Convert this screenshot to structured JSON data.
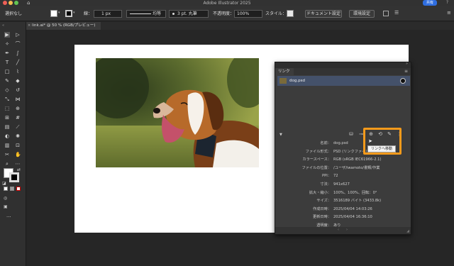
{
  "app": {
    "title": "Adobe Illustrator 2025",
    "share_label": "共有"
  },
  "control_bar": {
    "selection_label": "選択なし",
    "stroke_label": "線：",
    "stroke_value": "1 px",
    "uniform_label": "均等",
    "brush_label": "3 pt. 丸筆",
    "opacity_label": "不透明度：",
    "opacity_value": "100%",
    "style_label": "スタイル：",
    "doc_settings_button": "ドキュメント設定",
    "preferences_button": "環境設定"
  },
  "document_tab": {
    "label": "link.ai* @ 50 % (RGB/プレビュー)"
  },
  "links_panel": {
    "tab_label": "リンク",
    "link_item": "dog.psd",
    "tooltip": "リンクへ移動",
    "info": [
      {
        "label": "名前：",
        "value": "dog.psd"
      },
      {
        "label": "ファイル形式：",
        "value": "PSD (リンクファイル)"
      },
      {
        "label": "カラースペース：",
        "value": "RGB (sRGB IEC61966-2.1)"
      },
      {
        "label": "ファイルの位置：",
        "value": "/ユーザ/iwamoto/書類/作業"
      },
      {
        "label": "PPI：",
        "value": "72"
      },
      {
        "label": "寸法：",
        "value": "941x627"
      },
      {
        "label": "拡大・縮小：",
        "value": "100%、100%、回転：0°"
      },
      {
        "label": "サイズ：",
        "value": "3516189 バイト (3433.8k)"
      },
      {
        "label": "作成日時：",
        "value": "2025/04/04 14:03:26"
      },
      {
        "label": "更新日時：",
        "value": "2025/04/04 16:36:10"
      },
      {
        "label": "透明度：",
        "value": "あり"
      }
    ]
  },
  "colors": {
    "accent_highlight": "#f49a1b",
    "selection_row": "#44516a",
    "share_button": "#2f6ee0"
  }
}
